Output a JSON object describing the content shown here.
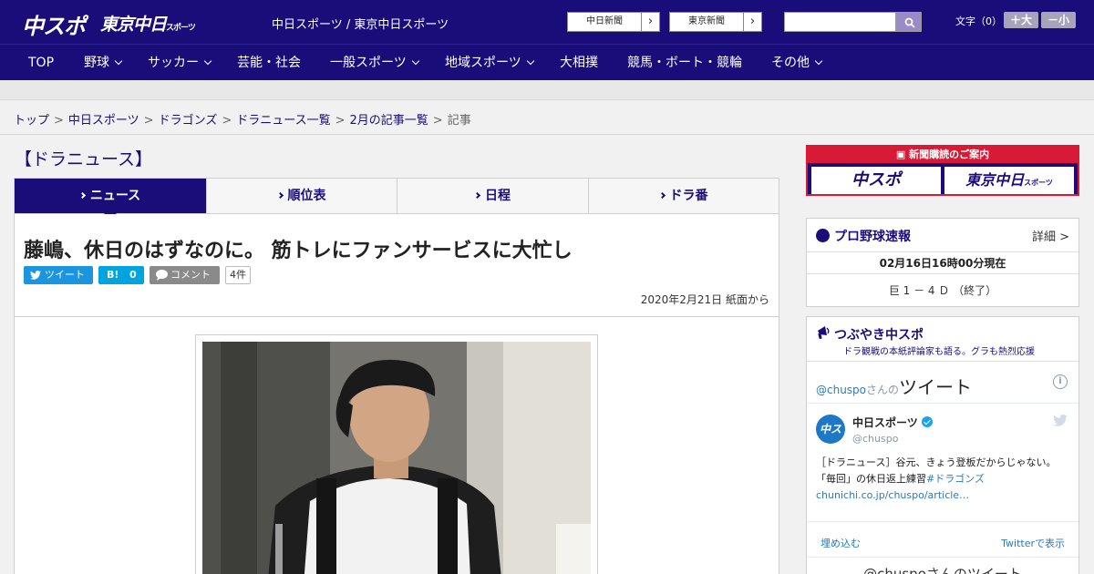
{
  "header": {
    "logo_chuspo": "中スポ",
    "logo_tokyo": "東京中日",
    "logo_tokyo_small": "スポーツ",
    "site_title": "中日スポーツ / 東京中日スポーツ",
    "links": [
      {
        "label": "中日新聞"
      },
      {
        "label": "東京新聞"
      }
    ],
    "search_placeholder": "",
    "font_size_label": "文字（0）",
    "font_bigger": "＋大",
    "font_smaller": "－小"
  },
  "nav": {
    "items": [
      {
        "label": "TOP",
        "has_dropdown": false
      },
      {
        "label": "野球",
        "has_dropdown": true
      },
      {
        "label": "サッカー",
        "has_dropdown": true
      },
      {
        "label": "芸能・社会",
        "has_dropdown": false
      },
      {
        "label": "一般スポーツ",
        "has_dropdown": true
      },
      {
        "label": "地域スポーツ",
        "has_dropdown": true
      },
      {
        "label": "大相撲",
        "has_dropdown": false
      },
      {
        "label": "競馬・ボート・競輪",
        "has_dropdown": false
      },
      {
        "label": "その他",
        "has_dropdown": true
      }
    ]
  },
  "breadcrumb": {
    "items": [
      "トップ",
      "中日スポーツ",
      "ドラゴンズ",
      "ドラニュース一覧",
      "2月の記事一覧"
    ],
    "separator": ">",
    "current": "記事"
  },
  "section_title": "【ドラニュース】",
  "tabs": [
    {
      "label": "ニュース",
      "active": true
    },
    {
      "label": "順位表",
      "active": false
    },
    {
      "label": "日程",
      "active": false
    },
    {
      "label": "ドラ番",
      "active": false
    }
  ],
  "article": {
    "headline": "藤嶋、休日のはずなのに。 筋トレにファンサービスに大忙し",
    "share": {
      "tweet_label": "ツイート",
      "hatena_label": "B!",
      "hatena_count": "0",
      "comment_label": "コメント",
      "comment_count": "4件"
    },
    "date": "2020年2月21日 紙面から"
  },
  "sidebar": {
    "ad": {
      "header": "新聞購読のご案内",
      "left_logo": "中スポ",
      "right_logo": "東京中日",
      "right_logo_small": "スポーツ"
    },
    "baseball": {
      "title": "プロ野球速報",
      "detail": "詳細 >",
      "timestamp": "02月16日16時00分現在",
      "score_line": "巨 1 － 4 Ｄ （終了）"
    },
    "tsubuyaki": {
      "title": "つぶやき中スポ",
      "subtitle": "ドラ観戦の本紙評論家も語る。グラも熱烈応援",
      "handle_prefix": "@chuspo",
      "handle_suffix": "さんの",
      "handle_word": "ツイート",
      "info": "i",
      "account_name": "中日スポーツ",
      "account_handle": "@chuspo",
      "avatar_text": "中スポ",
      "tweet_text": "［ドラニュース］谷元、きょう登板だからじゃない。「毎回」の休日返上練習",
      "tweet_hashtag": "#ドラゴンズ",
      "tweet_link": "chunichi.co.jp/chuspo/article…",
      "embed": "埋め込む",
      "view_on_twitter": "Twitterで表示",
      "footer_title": "@chuspoさんのツイート"
    }
  },
  "colors": {
    "brand_navy": "#1a0d7a",
    "accent_red": "#d91a36",
    "twitter_blue": "#1b95e0",
    "hatena_blue": "#00a4de"
  }
}
